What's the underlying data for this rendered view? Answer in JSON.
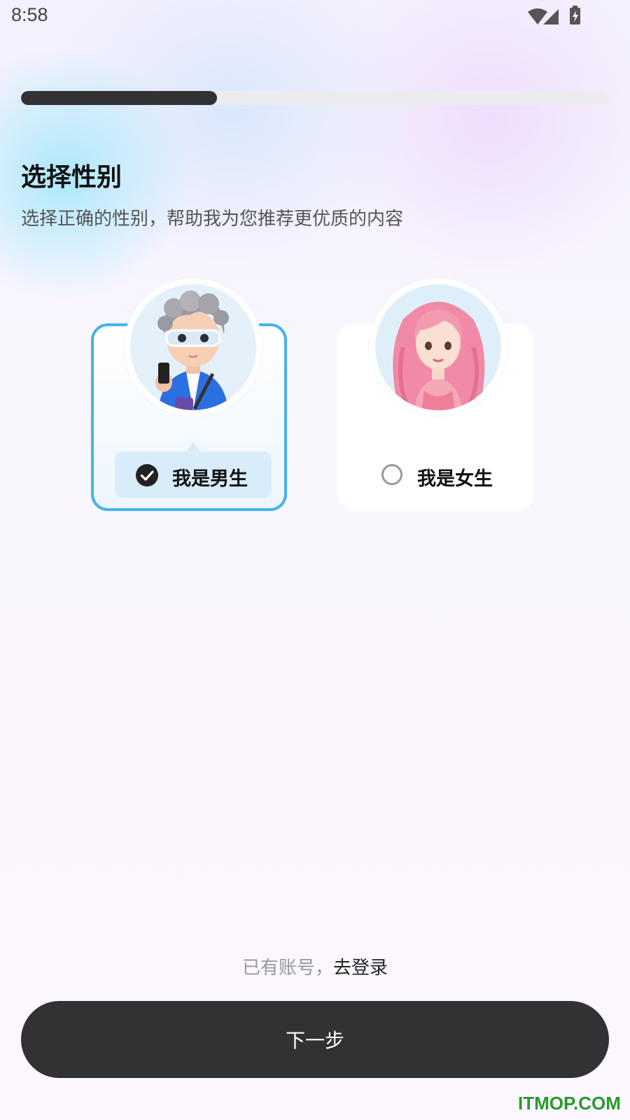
{
  "status_bar": {
    "time": "8:58",
    "icons": [
      "wifi-icon",
      "signal-icon",
      "battery-charging-icon"
    ]
  },
  "progress": {
    "fraction": 0.333,
    "fill_color": "#323234",
    "track_color": "#ececf0"
  },
  "header": {
    "title": "选择性别",
    "subtitle": "选择正确的性别，帮助我为您推荐更优质的内容"
  },
  "options": [
    {
      "label": "我是男生",
      "selected": true,
      "avatar": "male-cartoon-avatar",
      "accent_color": "#45b2ee"
    },
    {
      "label": "我是女生",
      "selected": false,
      "avatar": "female-cartoon-avatar"
    }
  ],
  "footer": {
    "login_prompt": "已有账号，",
    "login_link": "去登录",
    "next_button": "下一步"
  },
  "watermark": "ITMOP.COM"
}
